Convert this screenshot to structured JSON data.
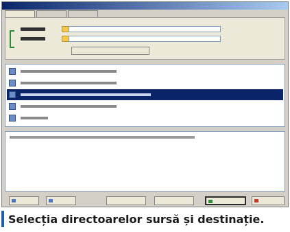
{
  "caption": {
    "text": "Selecția directoarelor sursă și destinație."
  },
  "colors": {
    "accent": "#0a246a",
    "caption_bar": "#1f5fa8",
    "folder_icon": "#f2c94c",
    "bracket": "#2e8b3a"
  },
  "icons": {
    "source_folder": "folder-icon",
    "destination_folder": "folder-icon",
    "list_item": "sync-icon",
    "ok_button": "checkmark-icon",
    "cancel_button": "close-icon"
  }
}
